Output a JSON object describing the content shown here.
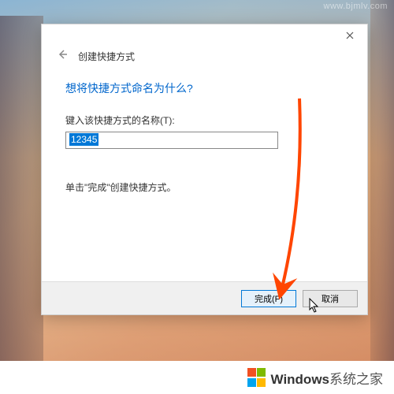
{
  "watermark": "www.bjmlv.com",
  "dialog": {
    "header_title": "创建快捷方式",
    "question": "想将快捷方式命名为什么?",
    "field_label": "键入该快捷方式的名称(T):",
    "input_value": "12345",
    "hint": "单击\"完成\"创建快捷方式。",
    "finish_label": "完成(F)",
    "cancel_label": "取消"
  },
  "footer": {
    "brand_bold": "Windows",
    "brand_rest": "系统之家",
    "logo_colors": [
      "#f25022",
      "#7fba00",
      "#00a4ef",
      "#ffb900"
    ]
  }
}
